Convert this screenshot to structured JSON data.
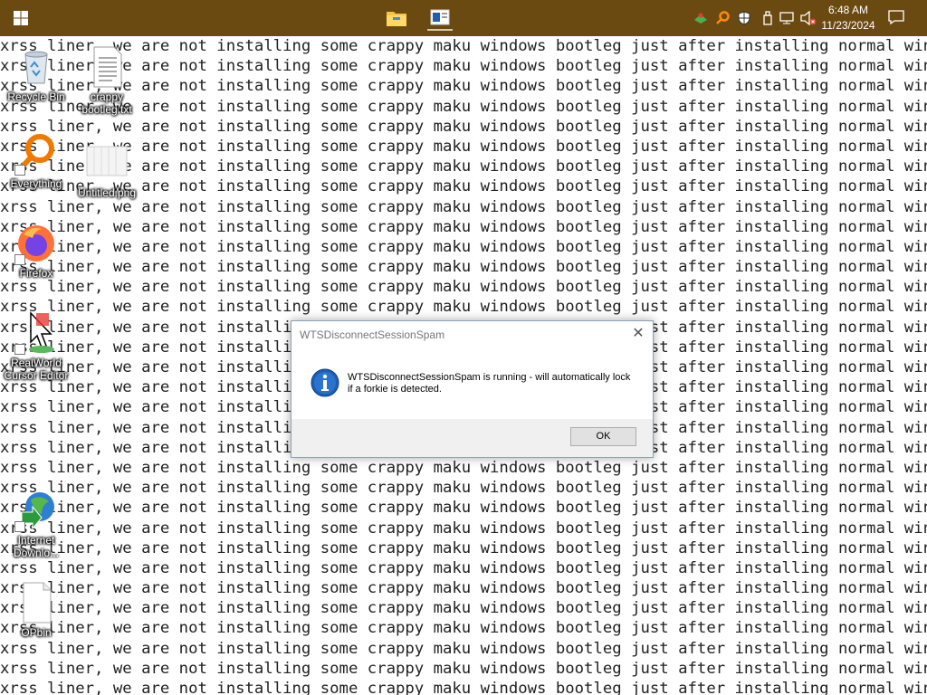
{
  "taskbar": {
    "start_icon": "windows-logo-icon",
    "pinned": [
      {
        "name": "file-explorer-icon"
      },
      {
        "name": "active-app-icon"
      }
    ],
    "tray_icons": [
      "network-share-icon",
      "everything-search-icon",
      "shield-icon",
      "usb-icon",
      "network-disconnected-icon",
      "volume-muted-icon"
    ],
    "clock_time": "6:48 AM",
    "clock_date": "11/23/2024",
    "notification_icon": "action-center-icon"
  },
  "wallpaper": {
    "text_line": "xrss liner, we are not installing some crappy maku windows bootleg just after installing normal windows",
    "line_count": 33
  },
  "desktop_icons": [
    {
      "label": "Recycle Bin",
      "icon": "recycle-bin-icon"
    },
    {
      "label": "crappy bootleg.txt",
      "icon": "text-file-icon"
    },
    {
      "label": "Everything",
      "icon": "everything-icon"
    },
    {
      "label": "Untitled.png",
      "icon": "image-file-icon"
    },
    {
      "label": "Firefox",
      "icon": "firefox-icon"
    },
    {
      "label": "RealWorld Cursor Editor",
      "icon": "cursor-editor-icon"
    },
    {
      "label": "Internet Downlo...",
      "icon": "internet-download-manager-icon"
    },
    {
      "label": "OPbin",
      "icon": "blank-file-icon"
    }
  ],
  "dialog": {
    "title": "WTSDisconnectSessionSpam",
    "message": "WTSDisconnectSessionSpam is running - will automatically lock if a forkie is detected.",
    "ok_label": "OK",
    "icon": "information-icon",
    "close_icon": "close-icon"
  }
}
